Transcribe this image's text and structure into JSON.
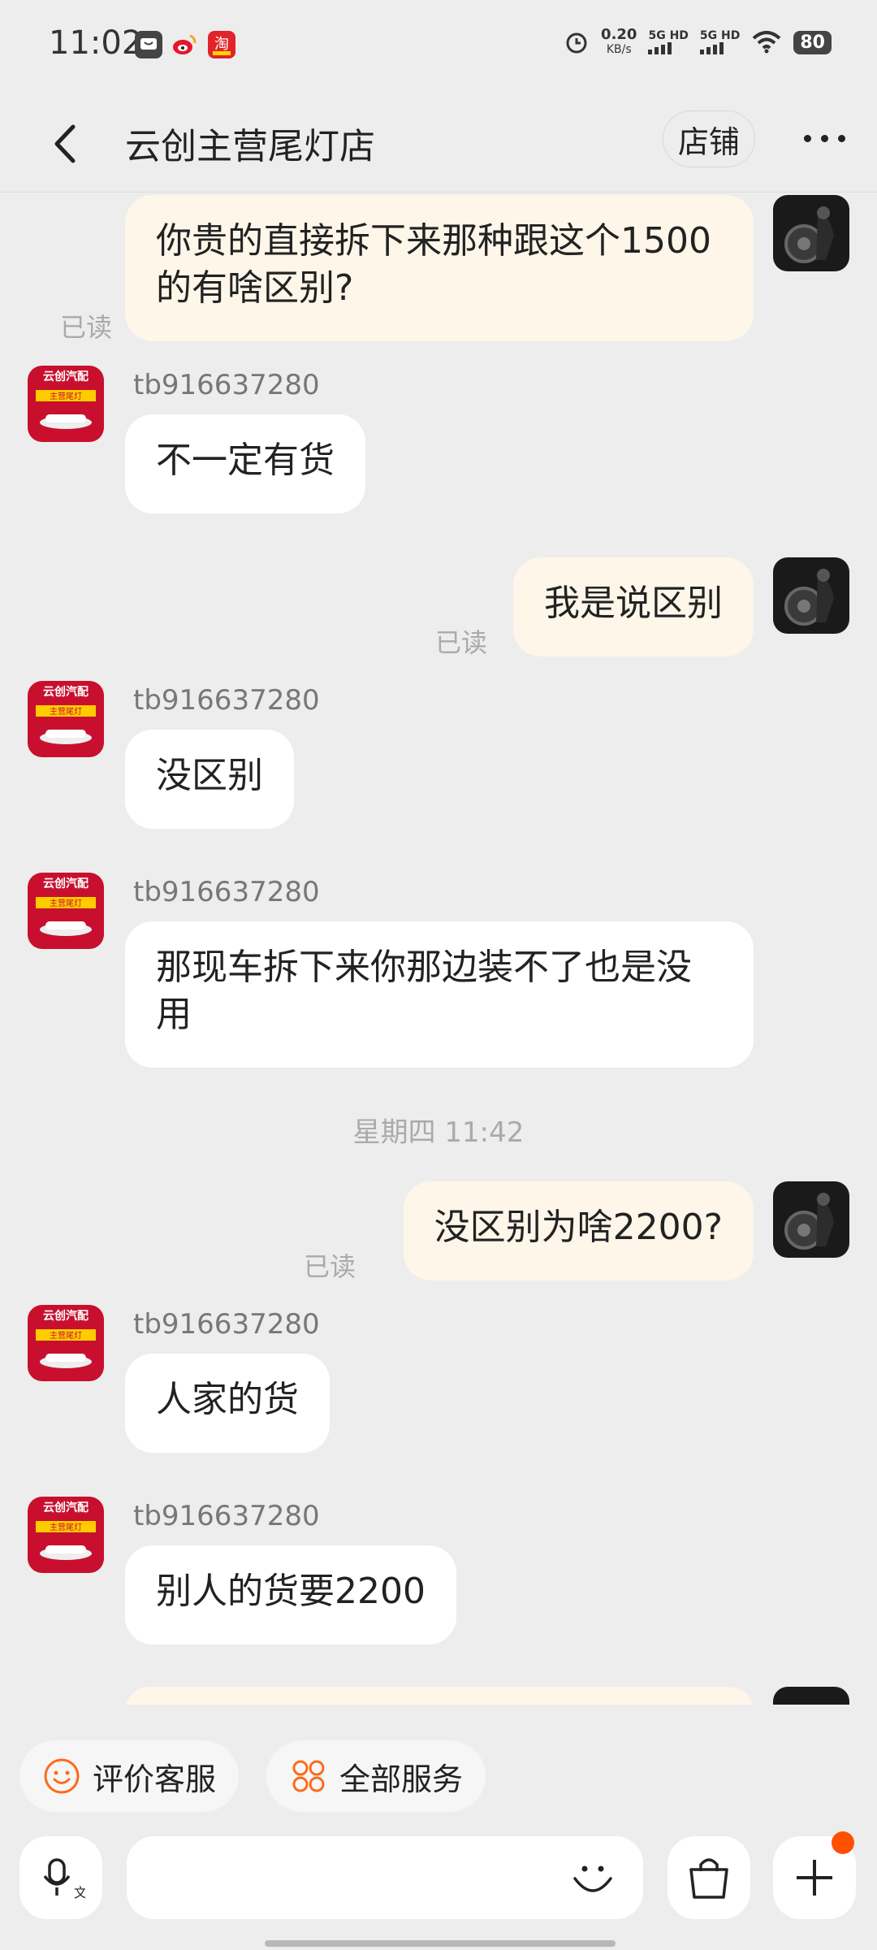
{
  "status_bar": {
    "time": "11:02",
    "speed_value": "0.20",
    "speed_unit": "KB/s",
    "signal1": "5G HD",
    "signal2": "5G HD",
    "battery": "80"
  },
  "header": {
    "title": "云创主营尾灯店",
    "store_button": "店铺"
  },
  "messages": [
    {
      "from": "me",
      "text": "你贵的直接拆下来那种跟这个1500的有啥区别?",
      "status": "已读"
    },
    {
      "from": "shop",
      "name": "tb916637280",
      "text": "不一定有货"
    },
    {
      "from": "me",
      "text": "我是说区别",
      "status": "已读"
    },
    {
      "from": "shop",
      "name": "tb916637280",
      "text": "没区别"
    },
    {
      "from": "shop",
      "name": "tb916637280",
      "text": "那现车拆下来你那边装不了也是没用"
    },
    {
      "from": "me",
      "text": "没区别为啥2200?",
      "status": "已读"
    },
    {
      "from": "shop",
      "name": "tb916637280",
      "text": "人家的货"
    },
    {
      "from": "shop",
      "name": "tb916637280",
      "text": "别人的货要2200"
    }
  ],
  "timestamp": "星期四 11:42",
  "quick_services": [
    {
      "label": "评价客服",
      "icon": "smile-face-icon"
    },
    {
      "label": "全部服务",
      "icon": "grid-services-icon"
    }
  ],
  "input_bar": {
    "voice_icon": "voice-translate-icon",
    "emoji_icon": "emoji-icon",
    "shop_icon": "shopping-bag-icon",
    "plus_icon": "plus-icon"
  },
  "colors": {
    "accent": "#ff5000",
    "my_bubble": "#fdf6e9",
    "their_bubble": "#ffffff",
    "background": "#ededed"
  }
}
